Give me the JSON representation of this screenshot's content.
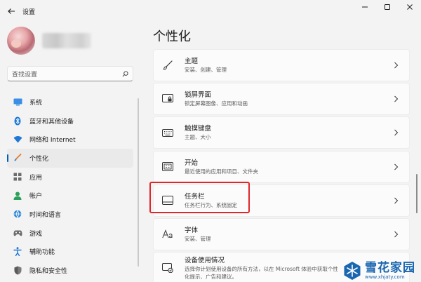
{
  "titlebar": {
    "app_title": "设置"
  },
  "search": {
    "placeholder": "查找设置"
  },
  "sidebar": {
    "items": [
      {
        "label": "系统",
        "icon": "monitor-icon"
      },
      {
        "label": "蓝牙和其他设备",
        "icon": "bluetooth-icon"
      },
      {
        "label": "网络和 Internet",
        "icon": "wifi-icon"
      },
      {
        "label": "个性化",
        "icon": "brush-icon",
        "active": true
      },
      {
        "label": "应用",
        "icon": "apps-icon"
      },
      {
        "label": "帐户",
        "icon": "account-icon"
      },
      {
        "label": "时间和语言",
        "icon": "globe-clock-icon"
      },
      {
        "label": "游戏",
        "icon": "gamepad-icon"
      },
      {
        "label": "辅助功能",
        "icon": "accessibility-icon"
      },
      {
        "label": "隐私和安全性",
        "icon": "shield-icon"
      }
    ]
  },
  "main": {
    "title": "个性化",
    "cards": [
      {
        "title": "主题",
        "subtitle": "安装、创建、管理",
        "icon": "brush-icon"
      },
      {
        "title": "锁屏界面",
        "subtitle": "锁定屏幕图像、应用和动画",
        "icon": "lock-screen-icon"
      },
      {
        "title": "触摸键盘",
        "subtitle": "主题、大小",
        "icon": "keyboard-icon"
      },
      {
        "title": "开始",
        "subtitle": "最近使用的应用和项目、文件夹",
        "icon": "start-icon"
      },
      {
        "title": "任务栏",
        "subtitle": "任务栏行为、系统固定",
        "icon": "taskbar-icon"
      },
      {
        "title": "字体",
        "subtitle": "安装、管理",
        "icon": "font-icon"
      },
      {
        "title": "设备使用情况",
        "subtitle": "选择你计划使用设备的所有方法，以在 Microsoft 体验中获取个性化提示、广告和建议。",
        "icon": "device-usage-icon"
      }
    ]
  },
  "watermark": {
    "brand": "雪花家园",
    "url": "www.xhjaty.com"
  },
  "colors": {
    "accent": "#005fb8",
    "highlight": "#e0262b",
    "watermark": "#1a66b0"
  }
}
